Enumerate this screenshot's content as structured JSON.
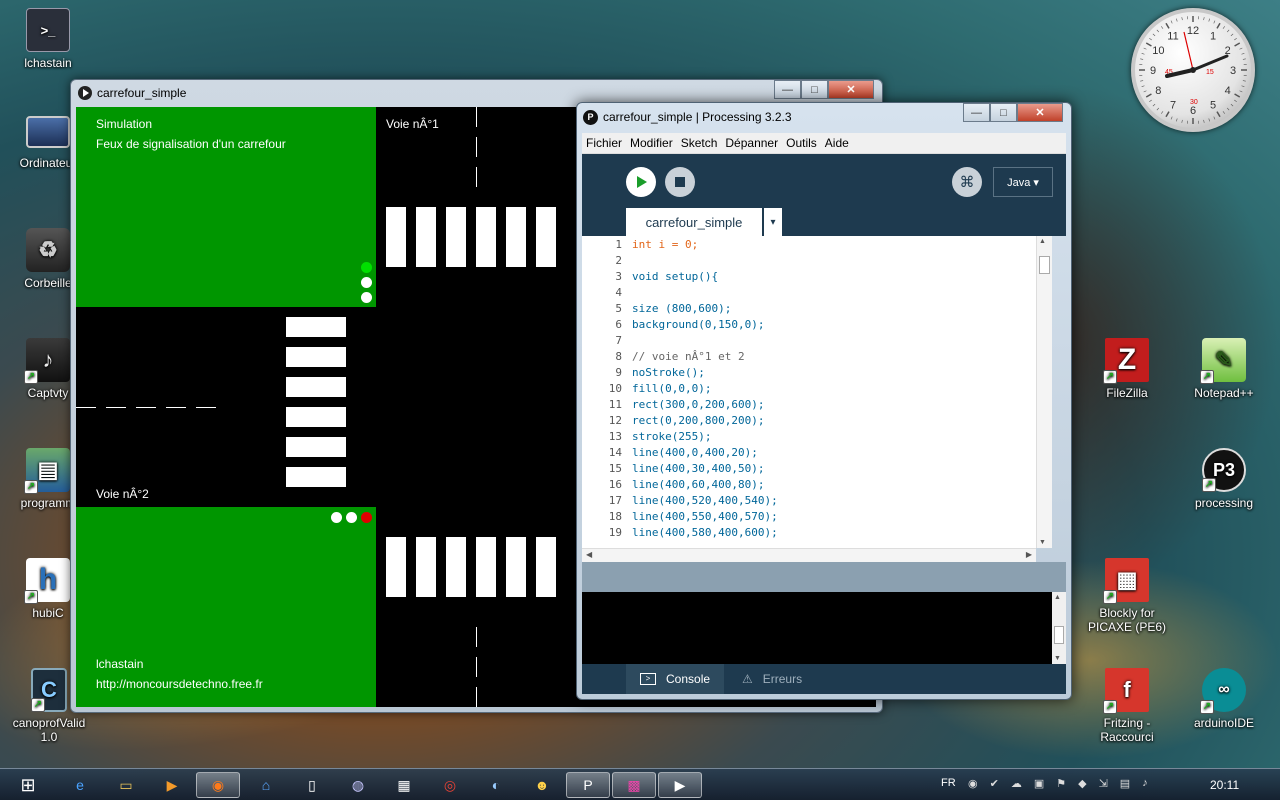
{
  "desktop": {
    "icons_left": [
      {
        "label": "lchastain",
        "icon": "terminal-icon"
      },
      {
        "label": "Ordinateur",
        "icon": "computer-icon"
      },
      {
        "label": "Corbeille",
        "icon": "recycle-bin-icon"
      },
      {
        "label": "Captvty",
        "icon": "captvty-icon"
      },
      {
        "label": "programm",
        "icon": "documents-icon"
      },
      {
        "label": "hubiC",
        "icon": "hubic-icon"
      },
      {
        "label": "canoprofValid 1.0",
        "icon": "canoprof-icon"
      }
    ],
    "icons_right": [
      {
        "label": "FileZilla",
        "icon": "filezilla-icon"
      },
      {
        "label": "Notepad++",
        "icon": "notepadpp-icon"
      },
      {
        "label": "processing",
        "icon": "processing-icon"
      },
      {
        "label": "Blockly for PICAXE (PE6)",
        "icon": "blockly-icon"
      },
      {
        "label": "Fritzing - Raccourci",
        "icon": "fritzing-icon"
      },
      {
        "label": "arduinoIDE",
        "icon": "arduino-icon"
      }
    ]
  },
  "sim_window": {
    "title": "carrefour_simple",
    "min": "—",
    "max": "□",
    "close": "✕",
    "texts": {
      "sim_title": "Simulation",
      "sim_subtitle": "Feux de signalisation d'un carrefour",
      "road1": "Voie nÂ°1",
      "road2": "Voie nÂ°2",
      "author": "lchastain",
      "url": "http://moncoursdetechno.free.fr"
    },
    "colors": {
      "background": "#009600",
      "road": "#000000",
      "marking": "#ffffff",
      "green_light": "#00e000",
      "red_light": "#e00000"
    },
    "lights_road1": [
      "green",
      "white",
      "white"
    ],
    "lights_road2": [
      "white",
      "white",
      "red"
    ]
  },
  "proc_window": {
    "title": "carrefour_simple | Processing 3.2.3",
    "min": "—",
    "max": "□",
    "close": "✕",
    "menu": [
      "Fichier",
      "Modifier",
      "Sketch",
      "Dépanner",
      "Outils",
      "Aide"
    ],
    "mode": "Java ▾",
    "tab": "carrefour_simple",
    "tab_arrow": "▾",
    "code": [
      {
        "n": "1",
        "t": "int i = 0;"
      },
      {
        "n": "2",
        "t": ""
      },
      {
        "n": "3",
        "t": "void setup(){"
      },
      {
        "n": "4",
        "t": ""
      },
      {
        "n": "5",
        "t": "size (800,600);"
      },
      {
        "n": "6",
        "t": "background(0,150,0);"
      },
      {
        "n": "7",
        "t": ""
      },
      {
        "n": "8",
        "t": "// voie nÂ°1 et 2"
      },
      {
        "n": "9",
        "t": "noStroke();"
      },
      {
        "n": "10",
        "t": "fill(0,0,0);"
      },
      {
        "n": "11",
        "t": "rect(300,0,200,600);"
      },
      {
        "n": "12",
        "t": "rect(0,200,800,200);"
      },
      {
        "n": "13",
        "t": "stroke(255);"
      },
      {
        "n": "14",
        "t": "line(400,0,400,20);"
      },
      {
        "n": "15",
        "t": "line(400,30,400,50);"
      },
      {
        "n": "16",
        "t": "line(400,60,400,80);"
      },
      {
        "n": "17",
        "t": "line(400,520,400,540);"
      },
      {
        "n": "18",
        "t": "line(400,550,400,570);"
      },
      {
        "n": "19",
        "t": "line(400,580,400,600);"
      }
    ],
    "console_tabs": [
      "Console",
      "Erreurs"
    ],
    "accent": "#1e3a4f"
  },
  "clock": {
    "numbers": [
      "12",
      "1",
      "2",
      "3",
      "4",
      "5",
      "6",
      "7",
      "8",
      "9",
      "10",
      "11"
    ],
    "sub_15": "15",
    "sub_30": "30",
    "sub_45": "45"
  },
  "taskbar": {
    "items": [
      "windows-start-icon",
      "ie-icon",
      "explorer-icon",
      "media-player-icon",
      "firefox-icon",
      "network-icon",
      "document-icon",
      "eclipse-icon",
      "calculator-icon",
      "chrome-icon",
      "gimp-icon",
      "shell-icon",
      "processing-icon",
      "paint-icon",
      "java-app-icon"
    ],
    "lang": "FR",
    "time": "20:11"
  }
}
